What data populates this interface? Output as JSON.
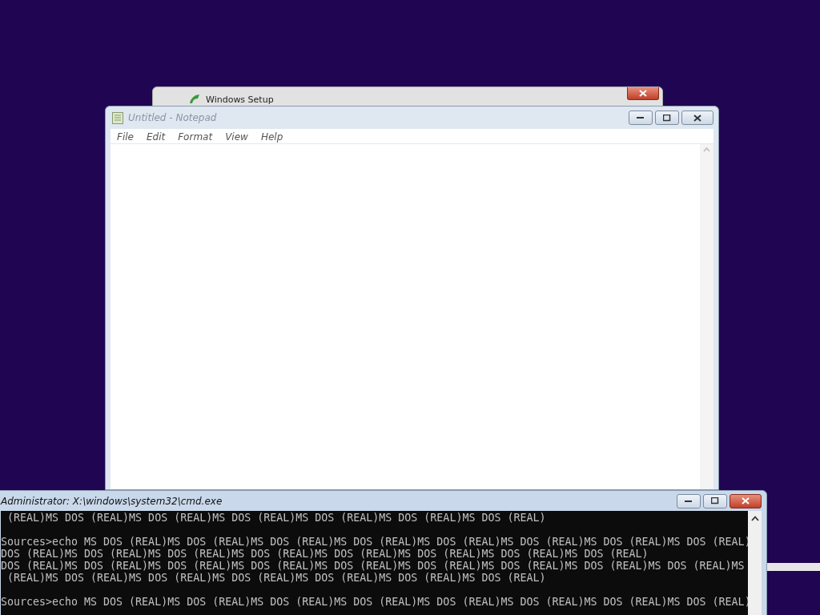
{
  "setup_window": {
    "title": "Windows Setup"
  },
  "notepad": {
    "title": "Untitled - Notepad",
    "active": false,
    "menu": [
      "File",
      "Edit",
      "Format",
      "View",
      "Help"
    ]
  },
  "cmd": {
    "title": "Administrator: X:\\windows\\system32\\cmd.exe",
    "active": true,
    "blocks": [
      [
        " (REAL)MS DOS (REAL)MS DOS (REAL)MS DOS (REAL)MS DOS (REAL)MS DOS (REAL)MS DOS (REAL)"
      ],
      [
        "Sources>echo MS DOS (REAL)MS DOS (REAL)MS DOS (REAL)MS DOS (REAL)MS DOS (REAL)MS DOS (REAL)MS DOS (REAL)MS DOS (REAL)",
        "DOS (REAL)MS DOS (REAL)MS DOS (REAL)MS DOS (REAL)MS DOS (REAL)MS DOS (REAL)MS DOS (REAL)MS DOS (REAL)",
        "DOS (REAL)MS DOS (REAL)MS DOS (REAL)MS DOS (REAL)MS DOS (REAL)MS DOS (REAL)MS DOS (REAL)MS DOS (REAL)MS DOS (REAL)MS",
        " (REAL)MS DOS (REAL)MS DOS (REAL)MS DOS (REAL)MS DOS (REAL)MS DOS (REAL)MS DOS (REAL)"
      ],
      [
        "Sources>echo MS DOS (REAL)MS DOS (REAL)MS DOS (REAL)MS DOS (REAL)MS DOS (REAL)MS DOS (REAL)MS DOS (REAL)MS DOS (REAL)"
      ]
    ]
  }
}
